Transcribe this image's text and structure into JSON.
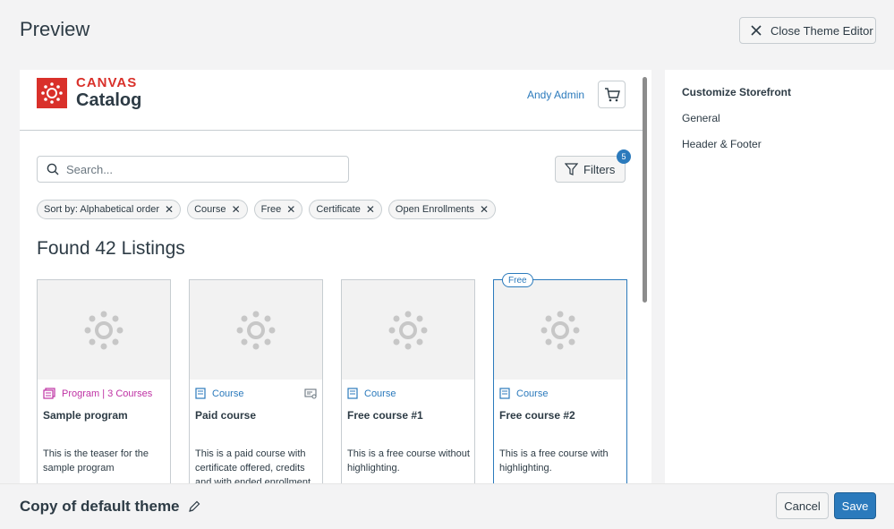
{
  "topbar": {
    "title": "Preview",
    "close_label": "Close Theme Editor"
  },
  "header": {
    "brand_top": "CANVAS",
    "brand_bottom": "Catalog",
    "user_name": "Andy Admin"
  },
  "search": {
    "placeholder": "Search...",
    "value": ""
  },
  "filters": {
    "label": "Filters",
    "count": "5"
  },
  "chips": [
    {
      "label": "Sort by: Alphabetical order"
    },
    {
      "label": "Course"
    },
    {
      "label": "Free"
    },
    {
      "label": "Certificate"
    },
    {
      "label": "Open Enrollments"
    }
  ],
  "found": "Found 42 Listings",
  "cards": [
    {
      "type": "Program | 3 Courses",
      "name": "Sample program",
      "teaser": "This is the teaser for the sample program"
    },
    {
      "type": "Course",
      "name": "Paid course",
      "teaser": "This is a paid course with certificate offered, credits and with ended enrollment"
    },
    {
      "type": "Course",
      "name": "Free course #1",
      "teaser": "This is a free course without highlighting."
    },
    {
      "type": "Course",
      "name": "Free course #2",
      "teaser": "This is a free course with highlighting.",
      "tag": "Free"
    }
  ],
  "sidebar": {
    "heading": "Customize Storefront",
    "links": [
      {
        "label": "General"
      },
      {
        "label": "Header & Footer"
      }
    ]
  },
  "footer": {
    "theme_name": "Copy of default theme",
    "cancel_label": "Cancel",
    "save_label": "Save"
  },
  "colors": {
    "brand_red": "#d9302a",
    "link_blue": "#2b7abc",
    "program_magenta": "#bf32a4"
  }
}
